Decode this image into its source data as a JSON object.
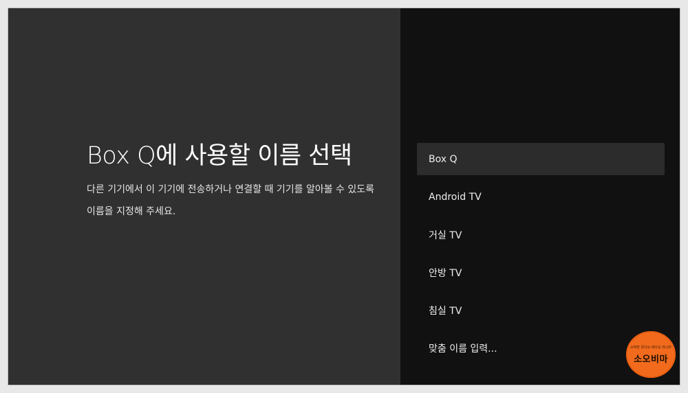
{
  "setup": {
    "title": "Box Q에 사용할 이름 선택",
    "description": "다른 기기에서 이 기기에 전송하거나 연결할 때 기기를 알아볼 수 있도록 이름을 지정해 주세요."
  },
  "options": [
    {
      "label": "Box Q",
      "selected": true
    },
    {
      "label": "Android TV",
      "selected": false
    },
    {
      "label": "거실 TV",
      "selected": false
    },
    {
      "label": "안방 TV",
      "selected": false
    },
    {
      "label": "침실 TV",
      "selected": false
    },
    {
      "label": "맞춤 이름 입력...",
      "selected": false
    }
  ],
  "watermark": {
    "small_text": "소박한 유다오 바다오 라니라",
    "big_text": "소오비마"
  },
  "colors": {
    "left_panel": "#303030",
    "right_panel": "#111111",
    "selected_option": "#2c2c2c",
    "badge": "#f26b1d"
  }
}
